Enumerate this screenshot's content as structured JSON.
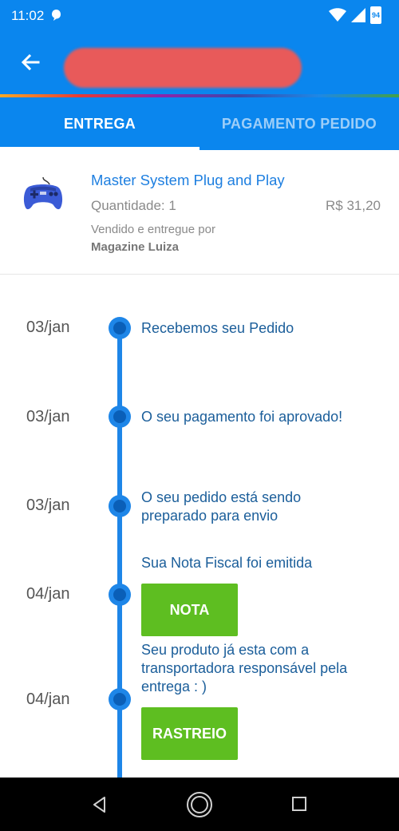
{
  "status_bar": {
    "time": "11:02",
    "battery": "94"
  },
  "app_bar": {
    "title": ""
  },
  "tabs": [
    {
      "label": "ENTREGA",
      "active": true
    },
    {
      "label": "PAGAMENTO PEDIDO",
      "active": false
    }
  ],
  "product": {
    "name": "Master System Plug and Play",
    "quantity": "Quantidade: 1",
    "price": "R$ 31,20",
    "sold_by_label": "Vendido e entregue por",
    "seller": "Magazine Luiza",
    "image_icon": "gamepad-icon"
  },
  "timeline": [
    {
      "date": "03/jan",
      "text": "Recebemos seu Pedido"
    },
    {
      "date": "03/jan",
      "text": "O seu pagamento foi aprovado!"
    },
    {
      "date": "03/jan",
      "text": "O seu pedido está sendo preparado para envio"
    },
    {
      "date": "04/jan",
      "text": "Sua Nota Fiscal foi emitida",
      "button": "NOTA"
    },
    {
      "date": "04/jan",
      "text": "Seu produto já esta com a transportadora responsável pela entrega : )",
      "button": "RASTREIO"
    }
  ],
  "colors": {
    "primary": "#0a86ee",
    "timeline": "#1e86e8",
    "button_green": "#5ebe21",
    "link_blue": "#1e7fe0"
  }
}
